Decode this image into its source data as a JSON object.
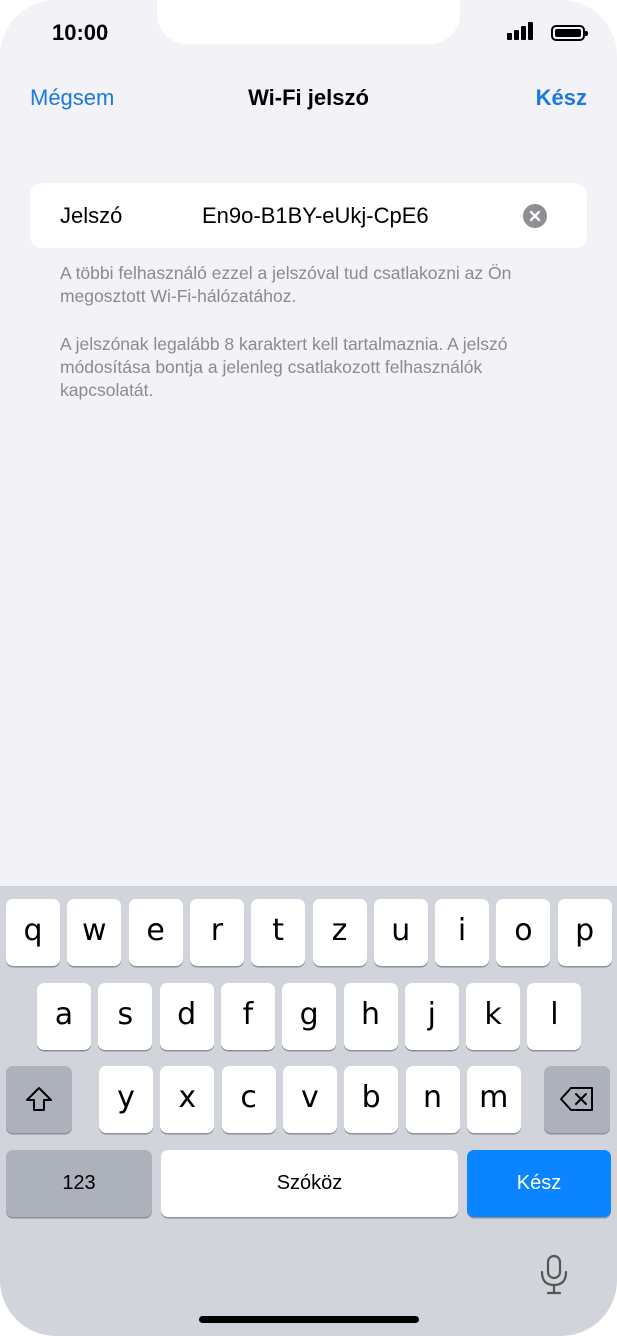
{
  "status_bar": {
    "time": "10:00"
  },
  "nav": {
    "cancel": "Mégsem",
    "title": "Wi-Fi jelszó",
    "done": "Kész"
  },
  "password_field": {
    "label": "Jelszó",
    "value": "En9o-B1BY-eUkj-CpE6",
    "clear_icon": "clear-circle-icon"
  },
  "notes": {
    "line1": "A többi felhasználó ezzel a jelszóval tud csatlakozni az Ön megosztott Wi-Fi-hálózatához.",
    "line2": "A jelszónak legalább 8 karaktert kell tartalmaznia. A jelszó módosítása bontja a jelenleg csatlakozott felhasználók kapcsolatát."
  },
  "keyboard": {
    "row1": [
      "q",
      "w",
      "e",
      "r",
      "t",
      "z",
      "u",
      "i",
      "o",
      "p"
    ],
    "row2": [
      "a",
      "s",
      "d",
      "f",
      "g",
      "h",
      "j",
      "k",
      "l"
    ],
    "row3": [
      "y",
      "x",
      "c",
      "v",
      "b",
      "n",
      "m"
    ],
    "numbers_key": "123",
    "space_key": "Szóköz",
    "return_key": "Kész",
    "shift_icon": "shift-icon",
    "backspace_icon": "backspace-icon",
    "mic_icon": "microphone-icon"
  },
  "colors": {
    "accent": "#1a7ae0",
    "return_key": "#0a84ff",
    "background": "#f2f2f7",
    "keyboard": "#d1d4db"
  }
}
